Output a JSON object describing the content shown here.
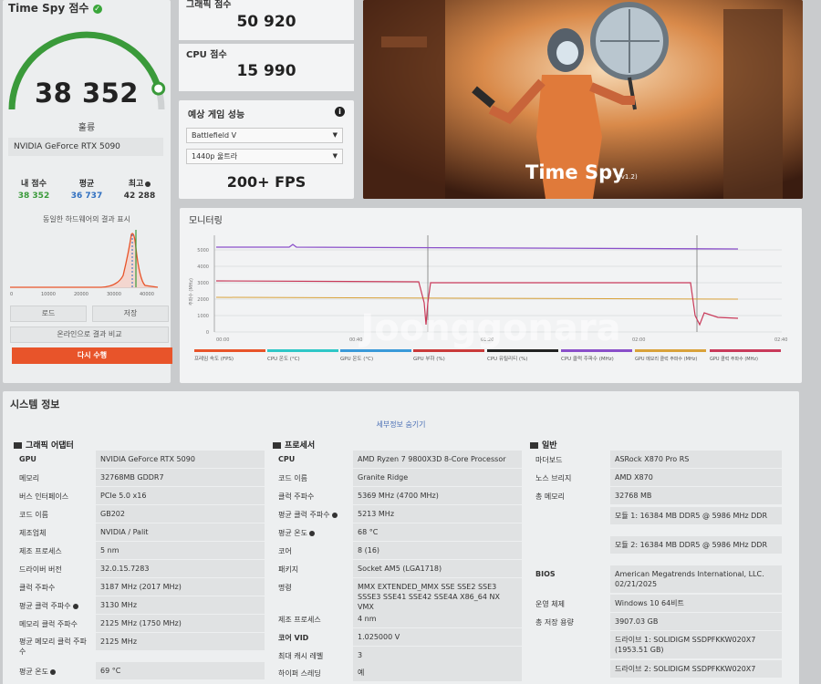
{
  "score_panel": {
    "title": "Time Spy 점수",
    "score": "38 352",
    "status": "훌륭",
    "gpu_name": "NVIDIA GeForce RTX 5090",
    "stats": [
      {
        "label": "내 점수",
        "value": "38 352",
        "color": "#3a9a3a"
      },
      {
        "label": "평균",
        "value": "36 737",
        "color": "#2f6fc0"
      },
      {
        "label": "최고",
        "value": "42 288",
        "color": "#333333"
      }
    ],
    "distribution_label": "동일한 하드웨어의 결과 표시",
    "dist_ticks": [
      "0",
      "10000",
      "20000",
      "30000",
      "40000"
    ],
    "load_button": "로드",
    "save_button": "저장",
    "compare_button": "온라인으로 결과 비교",
    "run_button": "다시 수행",
    "gauge_fraction": 0.91,
    "accent_color": "#3a9a3a"
  },
  "graphics_score": {
    "title": "그래픽 점수",
    "value": "50 920"
  },
  "cpu_score": {
    "title": "CPU 점수",
    "value": "15 990"
  },
  "game_perf": {
    "title": "예상 게임 성능",
    "game": "Battlefield V",
    "resolution": "1440p 울트라",
    "fps": "200+ FPS"
  },
  "hero": {
    "title": "Time Spy",
    "version": "(v1.2)"
  },
  "monitoring": {
    "title": "모니터링",
    "watermark": "Joonggonara",
    "y_ticks": [
      "5000",
      "4000",
      "3000",
      "2000",
      "1000",
      "0"
    ],
    "y_axis_label": "주파수 (MHz)",
    "x_ticks": [
      "00:00",
      "00:40",
      "01:20",
      "02:00",
      "02:40"
    ],
    "legend": [
      {
        "label": "프레임 속도 (FPS)",
        "color": "#e8542a"
      },
      {
        "label": "CPU 온도 (°C)",
        "color": "#2fc7c7"
      },
      {
        "label": "GPU 온도 (°C)",
        "color": "#3a9ad9"
      },
      {
        "label": "GPU 부하 (%)",
        "color": "#c93a3a"
      },
      {
        "label": "CPU 유틸리티 (%)",
        "color": "#222222"
      },
      {
        "label": "CPU 클럭 주파수 (MHz)",
        "color": "#8a4fc9"
      },
      {
        "label": "GPU 메모리 클럭 주파수 (MHz)",
        "color": "#d9a23a"
      },
      {
        "label": "GPU 클럭 주파수 (MHz)",
        "color": "#c93a5a"
      }
    ]
  },
  "system_info": {
    "title": "시스템 정보",
    "toggle_link": "세부정보 숨기기",
    "gpu_section": {
      "header": "그래픽 어댑터",
      "rows": [
        {
          "k": "GPU",
          "v": "NVIDIA GeForce RTX 5090"
        },
        {
          "k": "메모리",
          "v": "32768MB GDDR7"
        },
        {
          "k": "버스 인터페이스",
          "v": "PCIe 5.0 x16"
        },
        {
          "k": "코드 이름",
          "v": "GB202"
        },
        {
          "k": "제조업체",
          "v": "NVIDIA / Palit"
        },
        {
          "k": "제조 프로세스",
          "v": "5 nm"
        },
        {
          "k": "드라이버 버전",
          "v": "32.0.15.7283"
        },
        {
          "k": "클럭 주파수",
          "v": "3187 MHz (2017 MHz)"
        },
        {
          "k": "평균 클럭 주파수",
          "v": "3130 MHz"
        },
        {
          "k": "메모리 클럭 주파수",
          "v": "2125 MHz (1750 MHz)"
        },
        {
          "k": "평균 메모리 클럭 주파수",
          "v": "2125 MHz"
        },
        {
          "k": "평균 온도",
          "v": "69 °C"
        }
      ]
    },
    "cpu_section": {
      "header": "프로세서",
      "rows": [
        {
          "k": "CPU",
          "v": "AMD Ryzen 7 9800X3D 8-Core Processor"
        },
        {
          "k": "코드 이름",
          "v": "Granite Ridge"
        },
        {
          "k": "클럭 주파수",
          "v": "5369 MHz (4700 MHz)"
        },
        {
          "k": "평균 클럭 주파수",
          "v": "5213 MHz"
        },
        {
          "k": "평균 온도",
          "v": "68 °C"
        },
        {
          "k": "코어",
          "v": "8 (16)"
        },
        {
          "k": "패키지",
          "v": "Socket AM5 (LGA1718)"
        },
        {
          "k": "명령",
          "v": "MMX EXTENDED_MMX SSE SSE2 SSE3 SSSE3 SSE41 SSE42 SSE4A X86_64 NX VMX"
        },
        {
          "k": "제조 프로세스",
          "v": "4 nm"
        },
        {
          "k": "코어 VID",
          "v": "1.025000 V"
        },
        {
          "k": "최대 캐시 레벨",
          "v": "3"
        },
        {
          "k": "하이퍼 스레딩",
          "v": "예"
        }
      ]
    },
    "general_section": {
      "header": "일반",
      "rows": [
        {
          "k": "마더보드",
          "v": "ASRock X870 Pro RS"
        },
        {
          "k": "노스 브리지",
          "v": "AMD X870"
        },
        {
          "k": "총 메모리",
          "v": "32768 MB"
        },
        {
          "k": "",
          "v": "모듈 1: 16384 MB DDR5 @ 5986 MHz DDR"
        },
        {
          "k": "",
          "v": "모듈 2: 16384 MB DDR5 @ 5986 MHz DDR"
        },
        {
          "k": "BIOS",
          "v": "American Megatrends International, LLC. 02/21/2025"
        },
        {
          "k": "운영 체제",
          "v": "Windows 10 64비트"
        },
        {
          "k": "총 저장 용량",
          "v": "3907.03 GB"
        },
        {
          "k": "",
          "v": "드라이브 1: SOLIDIGM SSDPFKKW020X7 (1953.51 GB)"
        },
        {
          "k": "",
          "v": "드라이브 2: SOLIDIGM SSDPFKKW020X7"
        }
      ]
    }
  }
}
